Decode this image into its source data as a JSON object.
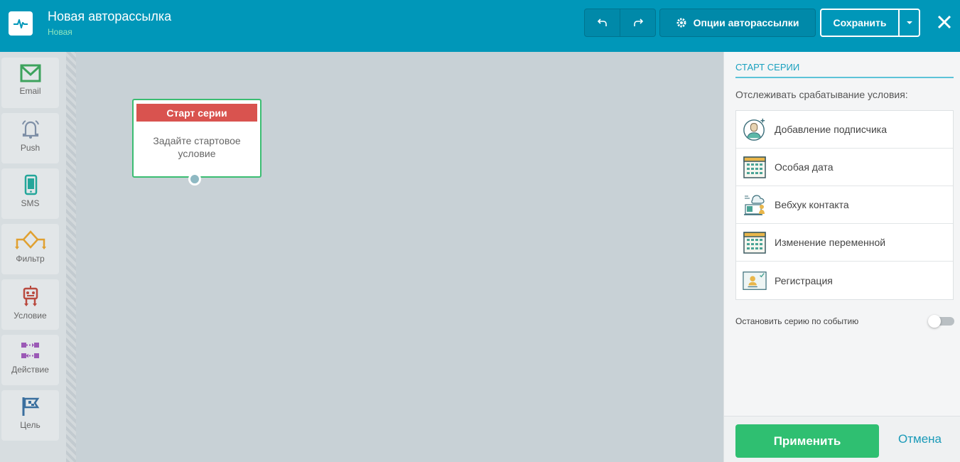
{
  "header": {
    "title": "Новая авторассылка",
    "status": "Новая",
    "options_label": "Опции авторассылки",
    "save_label": "Сохранить"
  },
  "toolbar": {
    "items": [
      {
        "label": "Email",
        "icon": "envelope-icon",
        "color": "#3da35d"
      },
      {
        "label": "Push",
        "icon": "bell-icon",
        "color": "#7e8fa6"
      },
      {
        "label": "SMS",
        "icon": "phone-icon",
        "color": "#23a69a"
      },
      {
        "label": "Фильтр",
        "icon": "filter-icon",
        "color": "#e0a030"
      },
      {
        "label": "Условие",
        "icon": "robot-icon",
        "color": "#b94a3f"
      },
      {
        "label": "Действие",
        "icon": "action-icon",
        "color": "#9b59b6"
      },
      {
        "label": "Цель",
        "icon": "flag-icon",
        "color": "#3a6f9e"
      }
    ]
  },
  "canvas": {
    "node": {
      "title": "Старт серии",
      "body": "Задайте стартовое условие"
    }
  },
  "panel": {
    "title": "СТАРТ СЕРИИ",
    "caption": "Отслеживать срабатывание условия:",
    "conditions": [
      {
        "label": "Добавление подписчика",
        "icon": "add-subscriber-icon"
      },
      {
        "label": "Особая дата",
        "icon": "calendar-icon"
      },
      {
        "label": "Вебхук контакта",
        "icon": "webhook-icon"
      },
      {
        "label": "Изменение переменной",
        "icon": "calendar-icon"
      },
      {
        "label": "Регистрация",
        "icon": "registration-icon"
      }
    ],
    "stop_label": "Остановить серию по событию",
    "apply_label": "Применить",
    "cancel_label": "Отмена"
  },
  "colors": {
    "header_bg": "#0097b9",
    "apply_green": "#2fbf71",
    "node_header_red": "#d9534f",
    "node_border_green": "#3bbd72",
    "accent_teal": "#1aa1bf"
  }
}
